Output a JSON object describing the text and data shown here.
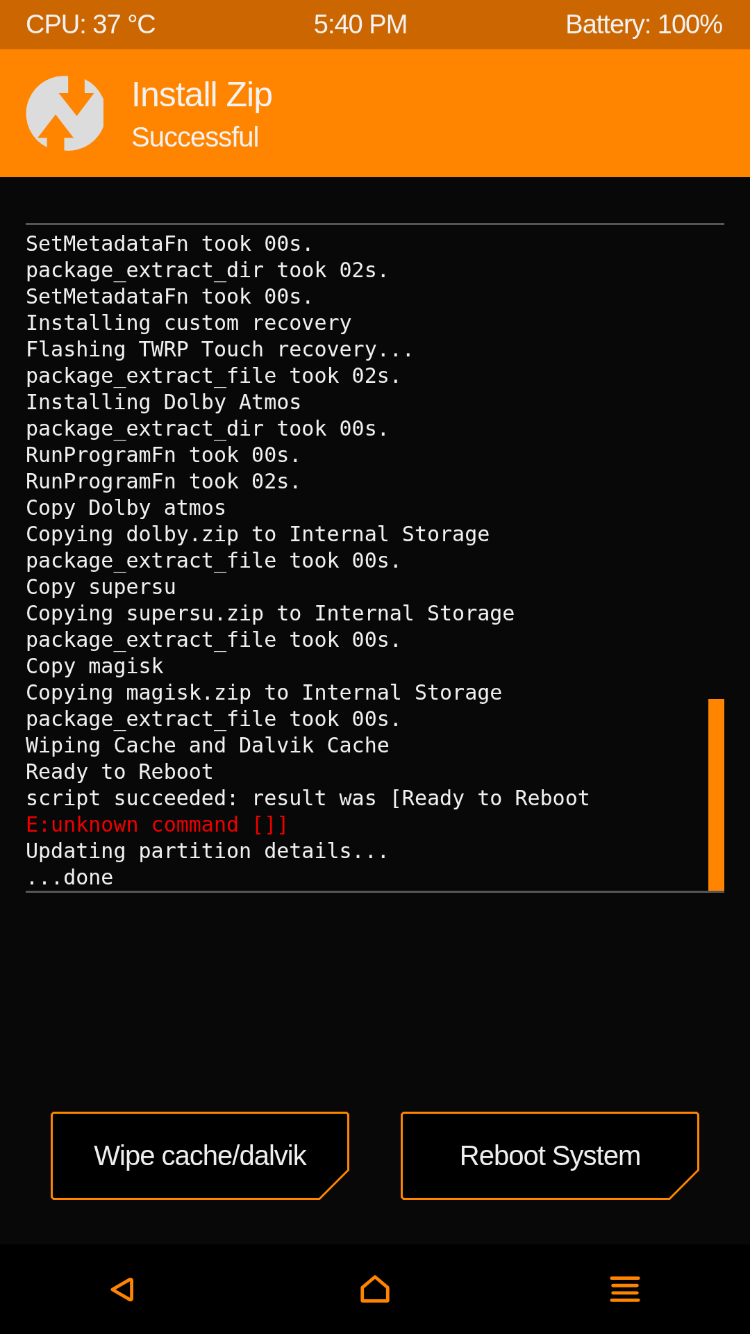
{
  "status_bar": {
    "cpu": "CPU: 37 °C",
    "time": "5:40 PM",
    "battery": "Battery: 100%"
  },
  "header": {
    "title": "Install Zip",
    "subtitle": "Successful"
  },
  "log": {
    "lines": [
      {
        "text": "SetMetadataFn took 00s.",
        "kind": "normal"
      },
      {
        "text": "package_extract_dir took 02s.",
        "kind": "normal"
      },
      {
        "text": "SetMetadataFn took 00s.",
        "kind": "normal"
      },
      {
        "text": "Installing custom recovery",
        "kind": "normal"
      },
      {
        "text": "Flashing TWRP Touch recovery...",
        "kind": "normal"
      },
      {
        "text": "package_extract_file took 02s.",
        "kind": "normal"
      },
      {
        "text": "Installing Dolby Atmos",
        "kind": "normal"
      },
      {
        "text": "package_extract_dir took 00s.",
        "kind": "normal"
      },
      {
        "text": "RunProgramFn took 00s.",
        "kind": "normal"
      },
      {
        "text": "RunProgramFn took 02s.",
        "kind": "normal"
      },
      {
        "text": "Copy Dolby atmos",
        "kind": "normal"
      },
      {
        "text": "Copying dolby.zip to Internal Storage",
        "kind": "normal"
      },
      {
        "text": "package_extract_file took 00s.",
        "kind": "normal"
      },
      {
        "text": "Copy supersu",
        "kind": "normal"
      },
      {
        "text": "Copying supersu.zip to Internal Storage",
        "kind": "normal"
      },
      {
        "text": "package_extract_file took 00s.",
        "kind": "normal"
      },
      {
        "text": "Copy magisk",
        "kind": "normal"
      },
      {
        "text": "Copying magisk.zip to Internal Storage",
        "kind": "normal"
      },
      {
        "text": "package_extract_file took 00s.",
        "kind": "normal"
      },
      {
        "text": "Wiping Cache and Dalvik Cache",
        "kind": "normal"
      },
      {
        "text": "Ready to Reboot",
        "kind": "normal"
      },
      {
        "text": "script succeeded: result was [Ready to Reboot",
        "kind": "normal"
      },
      {
        "text": "E:unknown command []]",
        "kind": "error"
      },
      {
        "text": "Updating partition details...",
        "kind": "normal"
      },
      {
        "text": "...done",
        "kind": "normal"
      }
    ]
  },
  "buttons": [
    {
      "label": "Wipe cache/dalvik"
    },
    {
      "label": "Reboot System"
    }
  ],
  "nav": [
    {
      "kind": "back"
    },
    {
      "kind": "home"
    },
    {
      "kind": "menu"
    }
  ]
}
